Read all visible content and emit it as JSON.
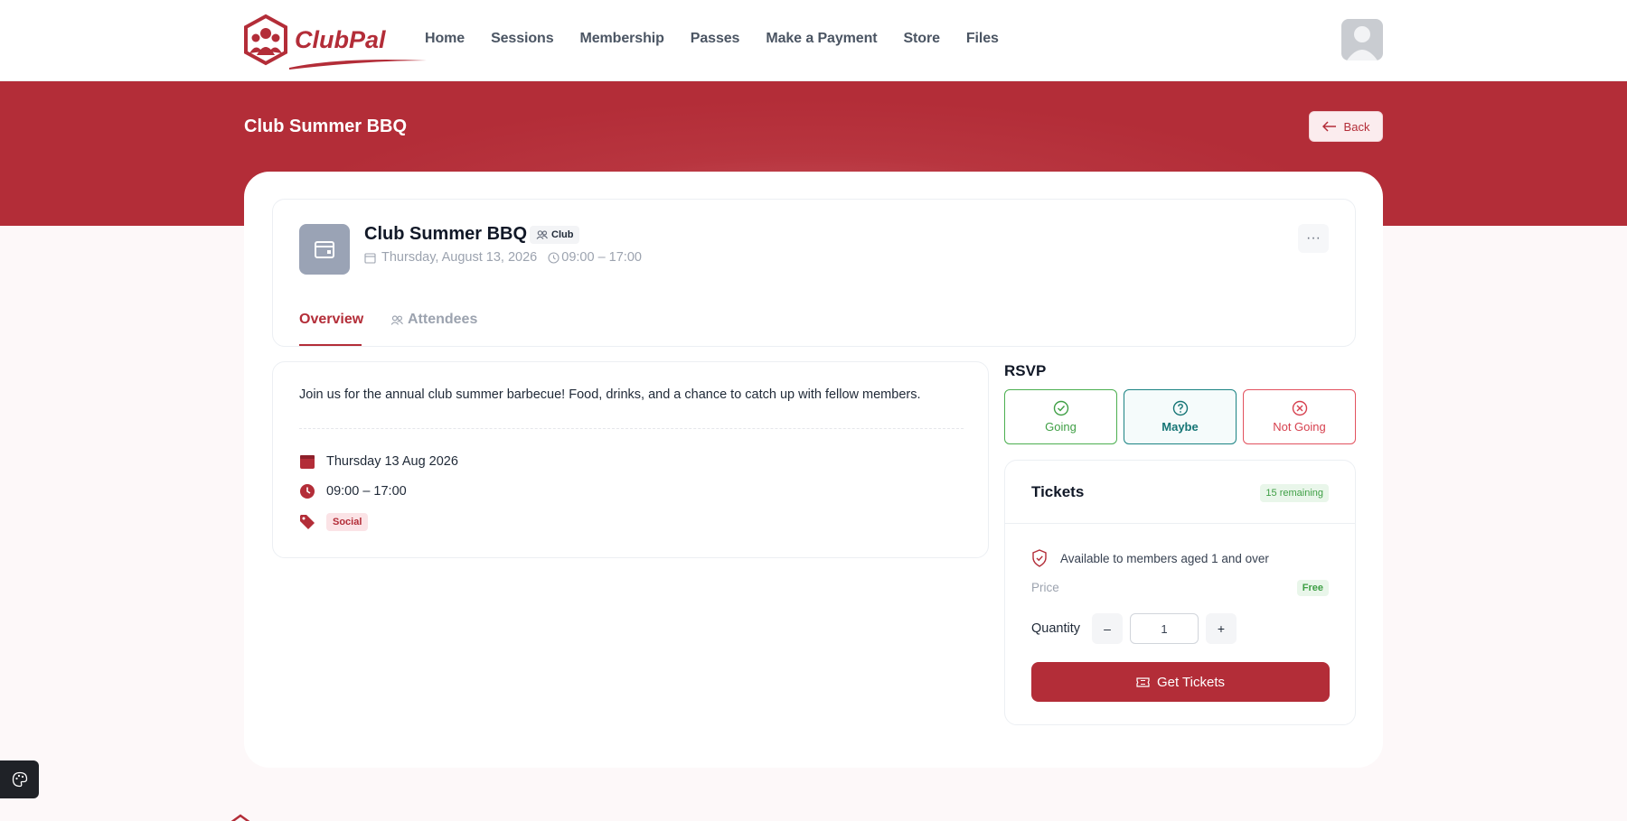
{
  "brand": {
    "name": "ClubPal",
    "accent": "#b32d38"
  },
  "nav": {
    "items": [
      "Home",
      "Sessions",
      "Membership",
      "Passes",
      "Make a Payment",
      "Store",
      "Files"
    ]
  },
  "banner": {
    "title": "Club Summer BBQ",
    "back_label": "Back"
  },
  "event": {
    "title": "Club Summer BBQ",
    "badge": "Club",
    "date": "Thursday, August 13, 2026",
    "time": "09:00 – 17:00",
    "more": "···"
  },
  "tabs": {
    "overview": "Overview",
    "attendees": "Attendees"
  },
  "overview": {
    "description": "Join us for the annual club summer barbecue! Food, drinks, and a chance to catch up with fellow members.",
    "date": "Thursday 13 Aug 2026",
    "time": "09:00 – 17:00",
    "tag": "Social"
  },
  "rsvp": {
    "title": "RSVP",
    "going": "Going",
    "maybe": "Maybe",
    "not_going": "Not Going"
  },
  "tickets": {
    "title": "Tickets",
    "remaining": "15 remaining",
    "availability": "Available to members aged 1 and over",
    "price_label": "Price",
    "price_value": "Free",
    "quantity_label": "Quantity",
    "minus": "–",
    "plus": "+",
    "quantity": "1",
    "cta": "Get Tickets"
  }
}
